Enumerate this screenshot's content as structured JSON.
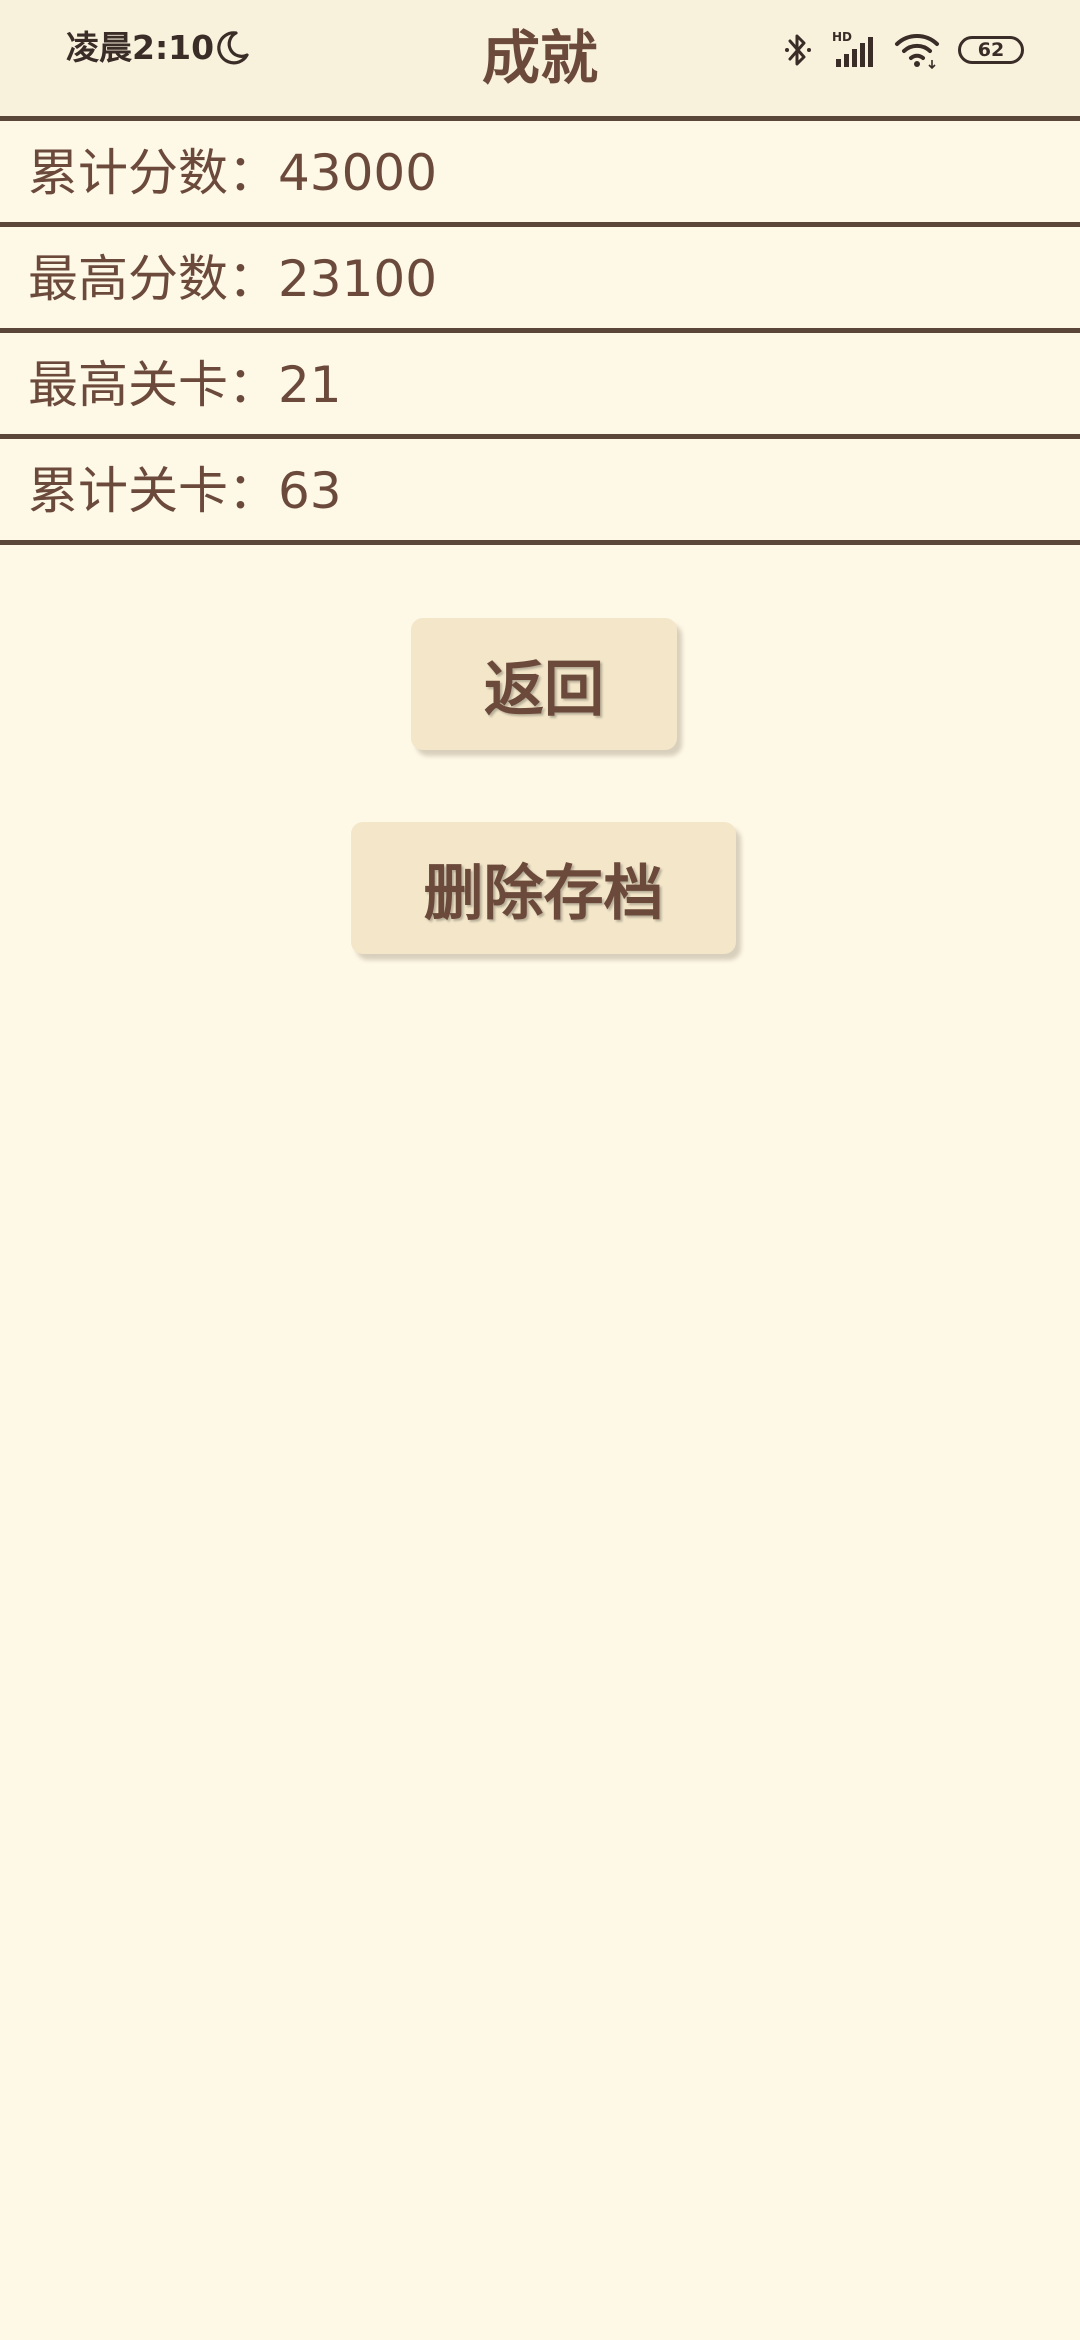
{
  "status_bar": {
    "time": "凌晨2:10",
    "hd_label": "HD",
    "battery": "62"
  },
  "header": {
    "title": "成就"
  },
  "stats": [
    {
      "label": "累计分数：43000"
    },
    {
      "label": "最高分数：23100"
    },
    {
      "label": "最高关卡：21"
    },
    {
      "label": "累计关卡：63"
    }
  ],
  "buttons": {
    "back_label": "返回",
    "delete_label": "删除存档"
  },
  "colors": {
    "background": "#fef8e6",
    "header_background": "#f8f1dc",
    "text": "#6b4a3c",
    "divider": "#5a4739",
    "button_background": "#f3e6c9"
  },
  "icons": {
    "moon": "moon-icon",
    "bluetooth": "bluetooth-icon",
    "signal": "signal-icon",
    "wifi": "wifi-icon",
    "battery": "battery-icon"
  }
}
